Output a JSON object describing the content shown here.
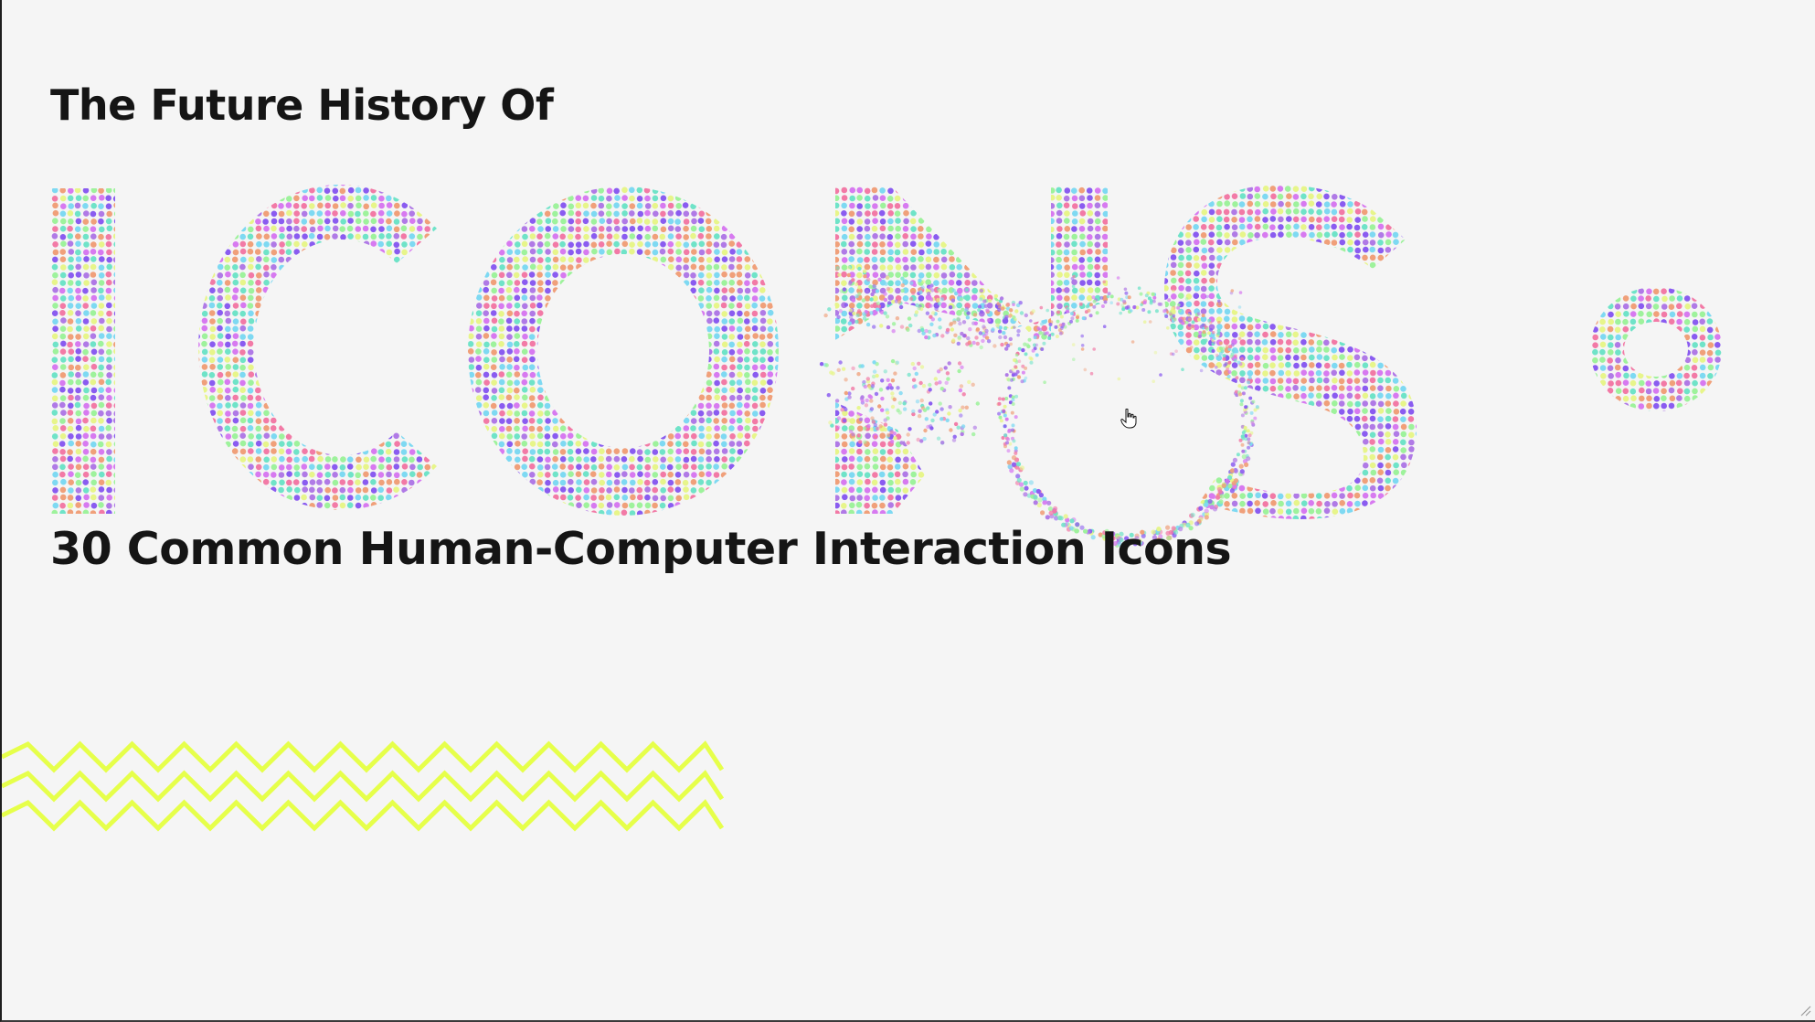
{
  "slide": {
    "kicker": "The Future History Of",
    "headline_word": "ICONS",
    "subtitle": "30 Common Human-Computer Interaction Icons"
  },
  "palette": {
    "background": "#f5f5f5",
    "text": "#151515",
    "dots": [
      "#b07ae6",
      "#8a5cf0",
      "#7ed9f2",
      "#9ef29c",
      "#f27aa6",
      "#e7f58a",
      "#6fe3c8",
      "#d77af0",
      "#f0a07a"
    ],
    "zigzag": "#e6ff4a"
  },
  "icons": {
    "cursor": "hand-pointer-icon",
    "particles": "particle-letters",
    "pattern": "zigzag-pattern",
    "resize": "resize-grip-icon"
  }
}
